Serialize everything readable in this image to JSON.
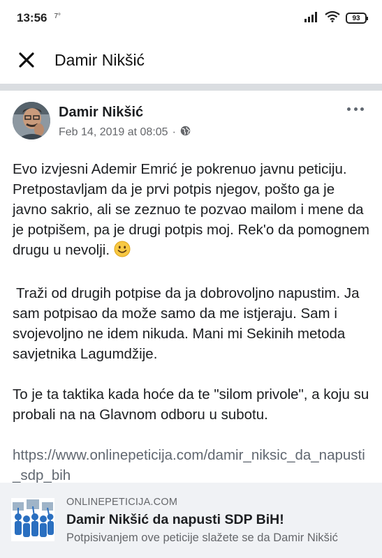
{
  "status_bar": {
    "time": "13:56",
    "temperature": "7°",
    "battery": "93",
    "icons": [
      "signal-icon",
      "wifi-icon",
      "battery-icon"
    ]
  },
  "nav": {
    "title": "Damir Nikšić",
    "close_icon": "close-icon"
  },
  "post": {
    "author": "Damir Nikšić",
    "date": "Feb 14, 2019 at 08:05",
    "meta_separator": "·",
    "privacy_icon": "globe-icon",
    "body": {
      "paragraph1": "Evo izvjesni Ademir Emrić je pokrenuo javnu peticiju. Pretpostavljam da je prvi potpis njegov, pošto ga je javno sakrio, ali se zeznuo te pozvao mailom i mene da je potpišem, pa je drugi potpis moj. Rek'o da pomognem drugu u nevolji.",
      "paragraph2": "Traži od drugih potpise da ja dobrovoljno napustim. Ja sam potpisao da može samo da me istjeraju. Sam i svojevoljno ne idem nikuda. Mani mi Sekinih metoda savjetnika Lagumdžije.",
      "paragraph3": "To je ta taktika kada hoće da te \"silom privole\", a koju su probali na na Glavnom odboru u subotu.",
      "link": "https://www.onlinepeticija.com/damir_niksic_da_napusti_sdp_bih"
    }
  },
  "link_card": {
    "domain": "ONLINEPETICIJA.COM",
    "title": "Damir Nikšić da napusti SDP BiH!",
    "description": "Potpisivanjem ove peticije slažete se da Damir Nikšić"
  },
  "colors": {
    "link": "#606770",
    "meta": "#65676b",
    "divider": "#dadde1",
    "card_bg": "#f0f2f5"
  }
}
